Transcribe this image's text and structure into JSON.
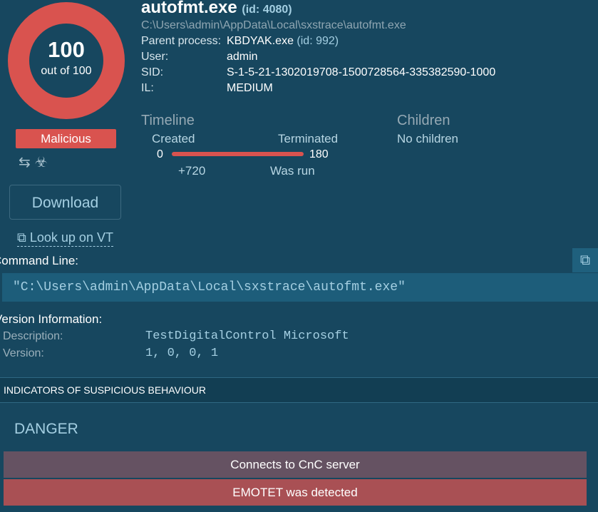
{
  "score": {
    "value": "100",
    "label": "out of 100",
    "fill_fraction": 1.0,
    "color": "#d9534f"
  },
  "verdict": "Malicious",
  "status_icons": [
    "arrows-exchange-icon",
    "biohazard-icon"
  ],
  "actions": {
    "download": "Download",
    "lookup": "Look up on VT"
  },
  "process": {
    "name": "autofmt.exe",
    "id": "(id: 4080)",
    "path": "C:\\Users\\admin\\AppData\\Local\\sxstrace\\autofmt.exe",
    "meta": [
      {
        "key": "Parent process:",
        "value": "KBDYAK.exe",
        "extra": "(id: 992)"
      },
      {
        "key": "User:",
        "value": "admin"
      },
      {
        "key": "SID:",
        "value": "S-1-5-21-1302019708-1500728564-335382590-1000"
      },
      {
        "key": "IL:",
        "value": "MEDIUM"
      }
    ]
  },
  "timeline": {
    "title": "Timeline",
    "created_label": "Created",
    "terminated_label": "Terminated",
    "start": "0",
    "end": "180",
    "offset": "+720",
    "status": "Was run"
  },
  "children": {
    "title": "Children",
    "value": "No children"
  },
  "command_line": {
    "title": "Command Line:",
    "value": "\"C:\\Users\\admin\\AppData\\Local\\sxstrace\\autofmt.exe\""
  },
  "version_info": {
    "title": "Version Information:",
    "rows": [
      {
        "key": "Description:",
        "value": "TestDigitalControl Microsoft"
      },
      {
        "key": "Version:",
        "value": "1, 0, 0, 1"
      }
    ]
  },
  "indicators": {
    "title": "INDICATORS OF SUSPICIOUS BEHAVIOUR",
    "level": "DANGER",
    "items": [
      {
        "label": "Connects to CnC server",
        "color": "#655262"
      },
      {
        "label": "EMOTET was detected",
        "color": "#a95054"
      }
    ]
  },
  "colors": {
    "background": "#17475f",
    "accent": "#a4cfe2",
    "danger": "#d9534f"
  }
}
